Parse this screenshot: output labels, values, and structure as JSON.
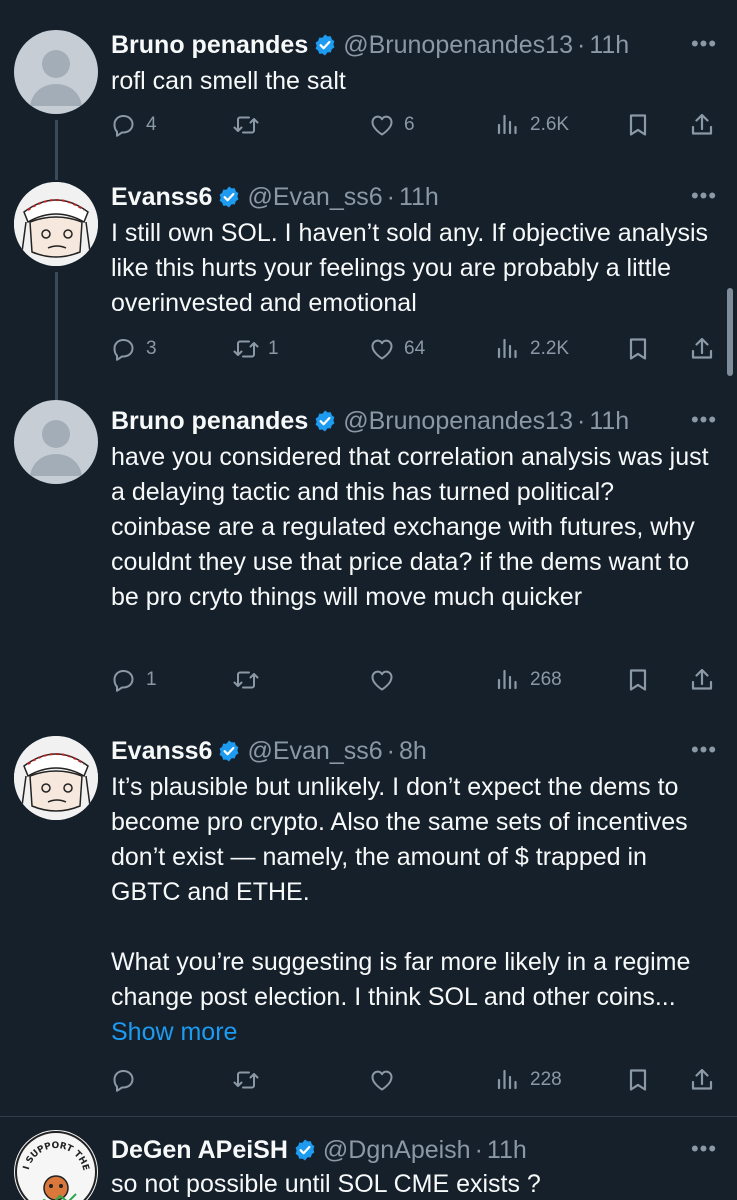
{
  "tweets": [
    {
      "name": "Bruno penandes",
      "handle": "@Brunopenandes13",
      "dot": "·",
      "time": "11h",
      "text": "rofl can smell the salt",
      "reply_count": "4",
      "retweet_count": "",
      "like_count": "6",
      "view_count": "2.6K"
    },
    {
      "name": "Evanss6",
      "handle": "@Evan_ss6",
      "dot": "·",
      "time": "11h",
      "text": "I still own SOL. I haven’t sold any. If objective analysis like this hurts your feelings you are probably a little overinvested and emotional",
      "reply_count": "3",
      "retweet_count": "1",
      "like_count": "64",
      "view_count": "2.2K"
    },
    {
      "name": "Bruno penandes",
      "handle": "@Brunopenandes13",
      "dot": "·",
      "time": "11h",
      "text": "have you considered that correlation analysis was just a delaying tactic and this has turned political? coinbase are a regulated exchange with futures, why couldnt they use that price data? if the dems want to be pro cryto things will move much quicker",
      "reply_count": "1",
      "retweet_count": "",
      "like_count": "",
      "view_count": "268"
    },
    {
      "name": "Evanss6",
      "handle": "@Evan_ss6",
      "dot": "·",
      "time": "8h",
      "text": "It’s plausible but unlikely. I don’t expect the dems to become pro crypto. Also the same sets of incentives don’t exist — namely, the amount of $ trapped in GBTC and ETHE.\n\nWhat you’re suggesting is far more likely in a regime change post election. I think SOL and other coins...",
      "show_more": "Show more",
      "reply_count": "",
      "retweet_count": "",
      "like_count": "",
      "view_count": "228"
    },
    {
      "name": "DeGen APeiSH",
      "handle": "@DgnApeish",
      "dot": "·",
      "time": "11h",
      "text": "so not possible until SOL CME exists ?",
      "avatar_text": "I SUPPORT THE"
    }
  ],
  "colors": {
    "background": "#15202b",
    "text": "#f7f9f9",
    "secondary": "#8b98a5",
    "verified": "#1d9bf0",
    "link": "#1d9bf0"
  }
}
